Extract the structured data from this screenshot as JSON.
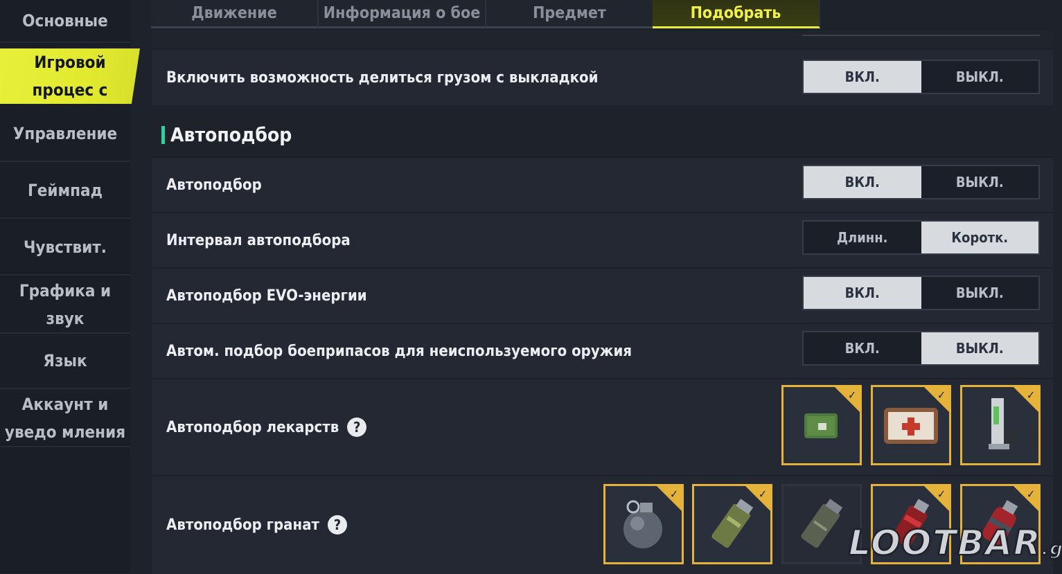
{
  "sidebar": {
    "items": [
      {
        "label": "Основные"
      },
      {
        "label": "Игровой процес с"
      },
      {
        "label": "Управление"
      },
      {
        "label": "Геймпад"
      },
      {
        "label": "Чувствит."
      },
      {
        "label": "Графика и звук"
      },
      {
        "label": "Язык"
      },
      {
        "label": "Аккаунт и уведо мления"
      }
    ],
    "active_index": 1
  },
  "tabs": [
    {
      "label": "Движение"
    },
    {
      "label": "Информация о бое"
    },
    {
      "label": "Предмет"
    },
    {
      "label": "Подобрать"
    }
  ],
  "active_tab": 3,
  "settings": {
    "share_loadout": {
      "label": "Включить возможность делиться грузом с выкладкой",
      "on": "ВКЛ.",
      "off": "ВЫКЛ.",
      "selected": "on"
    },
    "section_title": "Автоподбор",
    "auto_pickup": {
      "label": "Автоподбор",
      "on": "ВКЛ.",
      "off": "ВЫКЛ.",
      "selected": "on"
    },
    "interval": {
      "label": "Интервал автоподбора",
      "long": "Длинн.",
      "short": "Коротк.",
      "selected": "short"
    },
    "evo": {
      "label": "Автоподбор EVO-энергии",
      "on": "ВКЛ.",
      "off": "ВЫКЛ.",
      "selected": "on"
    },
    "ammo_unused": {
      "label": "Автом. подбор боеприпасов для неиспользуемого оружия",
      "on": "ВКЛ.",
      "off": "ВЫКЛ.",
      "selected": "off"
    },
    "medicine": {
      "label": "Автоподбор лекарств",
      "help": "?",
      "items": [
        {
          "icon": "bandage-icon",
          "checked": true
        },
        {
          "icon": "first-aid-kit-icon",
          "checked": true
        },
        {
          "icon": "adrenaline-syringe-icon",
          "checked": true
        }
      ]
    },
    "grenades": {
      "label": "Автоподбор гранат",
      "help": "?",
      "items": [
        {
          "icon": "frag-grenade-icon",
          "checked": true
        },
        {
          "icon": "smoke-grenade-icon",
          "checked": true
        },
        {
          "icon": "stun-grenade-icon",
          "checked": false
        },
        {
          "icon": "molotov-grenade-icon",
          "checked": true
        },
        {
          "icon": "red-grenade-icon",
          "checked": true
        }
      ]
    }
  },
  "watermark": {
    "brand": "LOOTBAR",
    "suffix": ".gg"
  },
  "colors": {
    "accent": "#e9ee3c",
    "tile_border": "#e6b33a",
    "section_bar": "#2fd0a2",
    "background": "#1d222b"
  }
}
